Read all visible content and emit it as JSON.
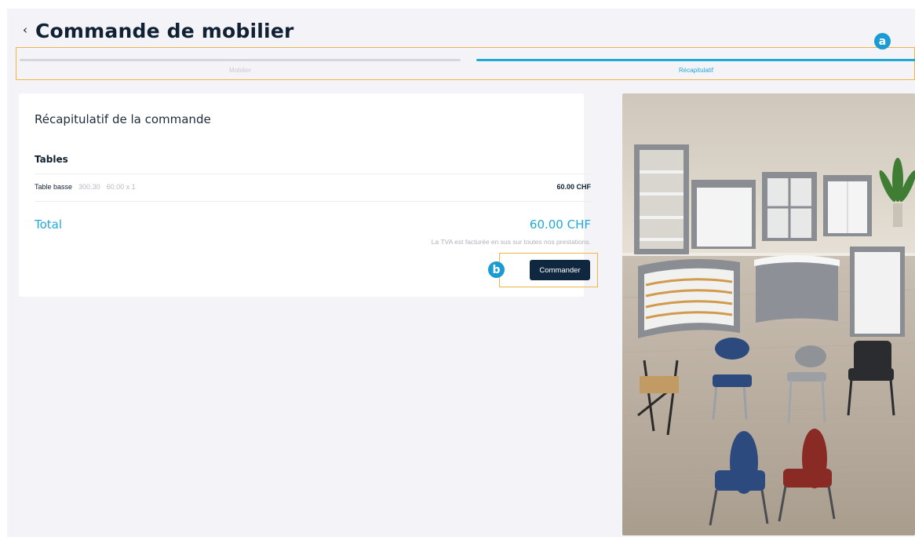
{
  "header": {
    "back_glyph": "‹",
    "title": "Commande de mobilier"
  },
  "stepper": {
    "steps": [
      {
        "label": "Mobilier",
        "state": "done"
      },
      {
        "label": "Récapitulatif",
        "state": "active"
      }
    ]
  },
  "markers": {
    "a": "a",
    "b": "b"
  },
  "summary": {
    "title": "Récapitulatif de la commande",
    "section_title": "Tables",
    "items": [
      {
        "name": "Table basse",
        "ref": "300.30",
        "qty": "60.00 x 1",
        "price": "60.00 CHF"
      }
    ],
    "total_label": "Total",
    "total_value": "60.00 CHF",
    "vat_note": "La TVA est facturée en sus sur toutes nos prestations.",
    "order_label": "Commander"
  },
  "colors": {
    "accent": "#21a9d6",
    "navy": "#0f2840",
    "highlight": "#f1b545",
    "background": "#f4f4f8"
  }
}
